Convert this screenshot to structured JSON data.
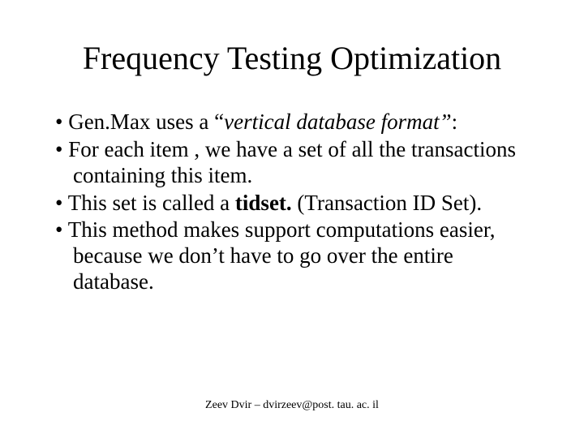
{
  "title": "Frequency Testing Optimization",
  "bullets": [
    {
      "pre": "Gen.Max uses a “",
      "emph": "vertical database format”",
      "post": ":"
    },
    {
      "pre": "For each item , we have a set of all the transactions containing this item.",
      "emph": "",
      "post": ""
    },
    {
      "pre": "This set is called a ",
      "bold": "tidset.",
      "post": " (Transaction ID Set)."
    },
    {
      "pre": "This method makes support computations easier, because we don’t have to go over the entire database.",
      "emph": "",
      "post": ""
    }
  ],
  "footer": "Zeev Dvir – dvirzeev@post. tau. ac. il"
}
